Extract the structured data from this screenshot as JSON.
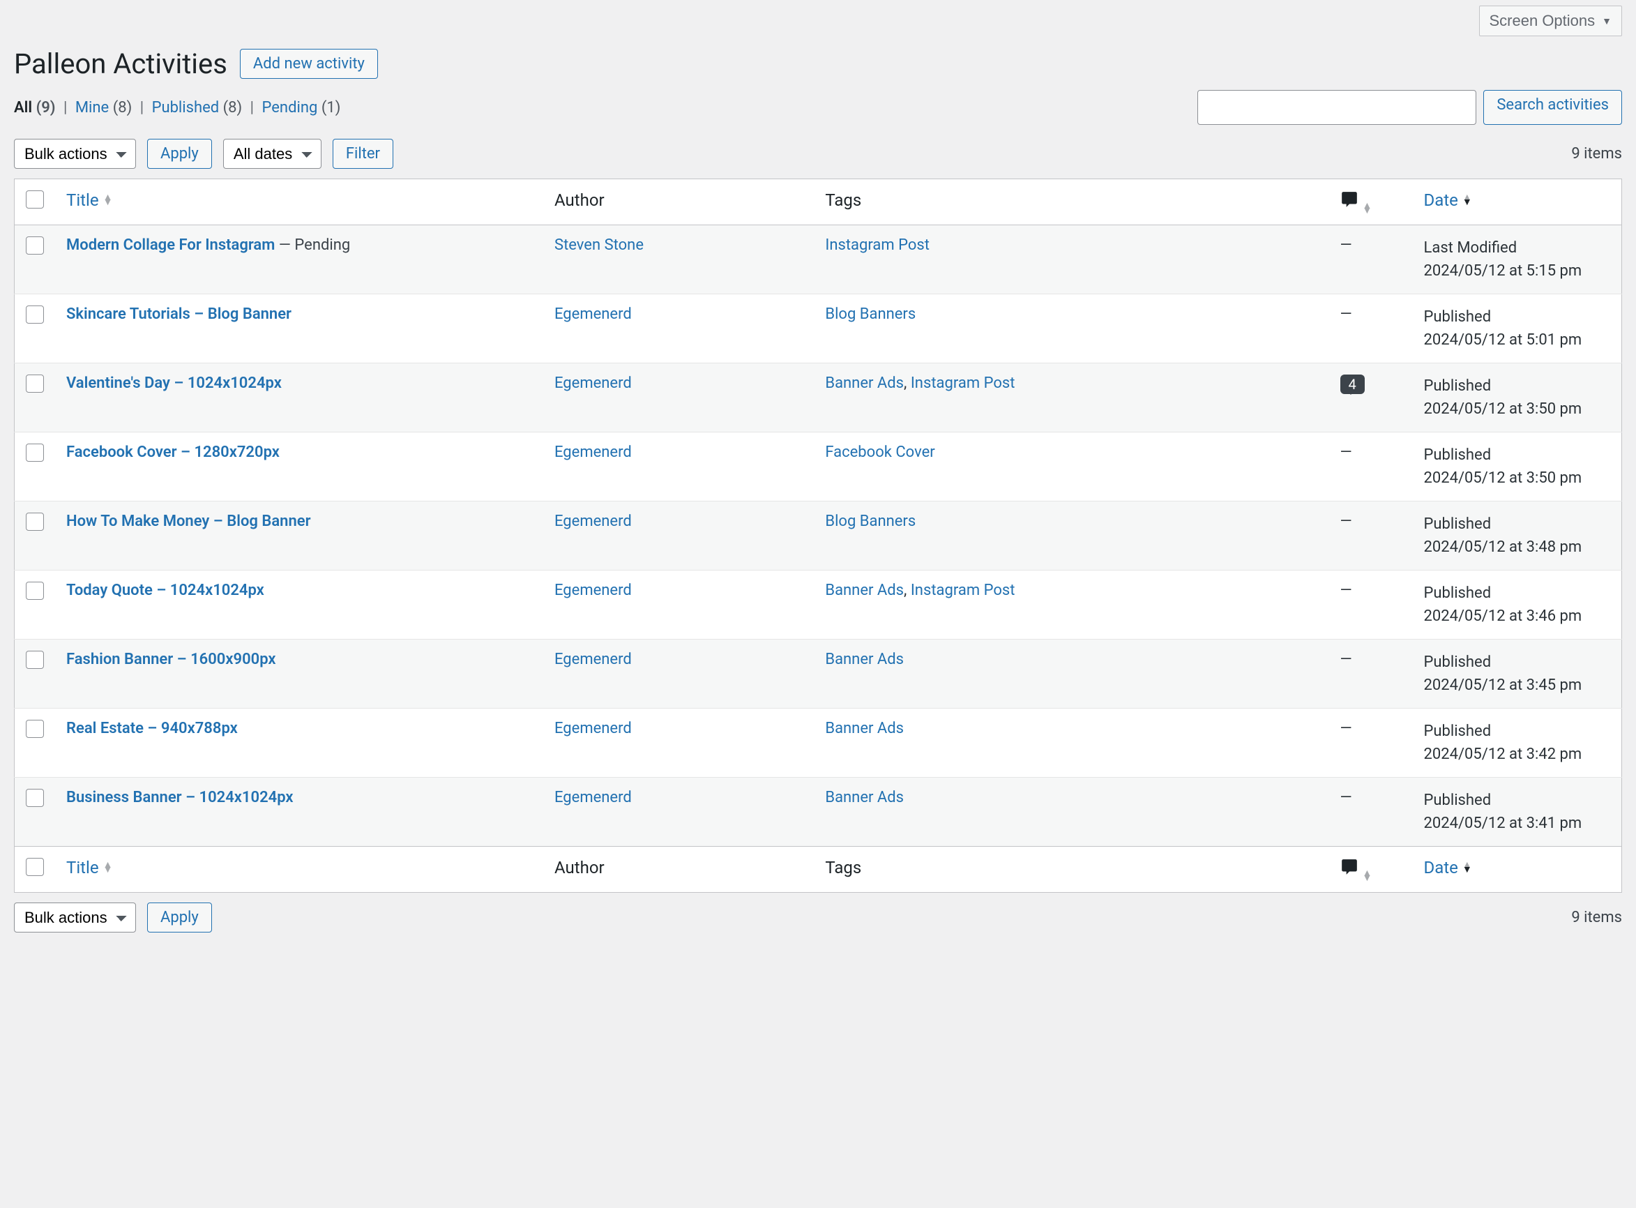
{
  "screen_options_label": "Screen Options",
  "page_title": "Palleon Activities",
  "add_new_label": "Add new activity",
  "filters": {
    "all_label": "All",
    "all_count": "(9)",
    "mine_label": "Mine",
    "mine_count": "(8)",
    "published_label": "Published",
    "published_count": "(8)",
    "pending_label": "Pending",
    "pending_count": "(1)"
  },
  "search_button_label": "Search activities",
  "bulk_actions_label": "Bulk actions",
  "apply_label": "Apply",
  "all_dates_label": "All dates",
  "filter_label": "Filter",
  "items_count_label": "9 items",
  "columns": {
    "title": "Title",
    "author": "Author",
    "tags": "Tags",
    "date": "Date"
  },
  "rows": [
    {
      "title": "Modern Collage For Instagram",
      "state": " — Pending",
      "author": "Steven Stone",
      "tags": [
        "Instagram Post"
      ],
      "comments": "—",
      "date_status": "Last Modified",
      "date_value": "2024/05/12 at 5:15 pm"
    },
    {
      "title": "Skincare Tutorials – Blog Banner",
      "state": "",
      "author": "Egemenerd",
      "tags": [
        "Blog Banners"
      ],
      "comments": "—",
      "date_status": "Published",
      "date_value": "2024/05/12 at 5:01 pm"
    },
    {
      "title": "Valentine's Day – 1024x1024px",
      "state": "",
      "author": "Egemenerd",
      "tags": [
        "Banner Ads",
        "Instagram Post"
      ],
      "comments": "4",
      "date_status": "Published",
      "date_value": "2024/05/12 at 3:50 pm"
    },
    {
      "title": "Facebook Cover – 1280x720px",
      "state": "",
      "author": "Egemenerd",
      "tags": [
        "Facebook Cover"
      ],
      "comments": "—",
      "date_status": "Published",
      "date_value": "2024/05/12 at 3:50 pm"
    },
    {
      "title": "How To Make Money – Blog Banner",
      "state": "",
      "author": "Egemenerd",
      "tags": [
        "Blog Banners"
      ],
      "comments": "—",
      "date_status": "Published",
      "date_value": "2024/05/12 at 3:48 pm"
    },
    {
      "title": "Today Quote – 1024x1024px",
      "state": "",
      "author": "Egemenerd",
      "tags": [
        "Banner Ads",
        "Instagram Post"
      ],
      "comments": "—",
      "date_status": "Published",
      "date_value": "2024/05/12 at 3:46 pm"
    },
    {
      "title": "Fashion Banner – 1600x900px",
      "state": "",
      "author": "Egemenerd",
      "tags": [
        "Banner Ads"
      ],
      "comments": "—",
      "date_status": "Published",
      "date_value": "2024/05/12 at 3:45 pm"
    },
    {
      "title": "Real Estate – 940x788px",
      "state": "",
      "author": "Egemenerd",
      "tags": [
        "Banner Ads"
      ],
      "comments": "—",
      "date_status": "Published",
      "date_value": "2024/05/12 at 3:42 pm"
    },
    {
      "title": "Business Banner – 1024x1024px",
      "state": "",
      "author": "Egemenerd",
      "tags": [
        "Banner Ads"
      ],
      "comments": "—",
      "date_status": "Published",
      "date_value": "2024/05/12 at 3:41 pm"
    }
  ]
}
